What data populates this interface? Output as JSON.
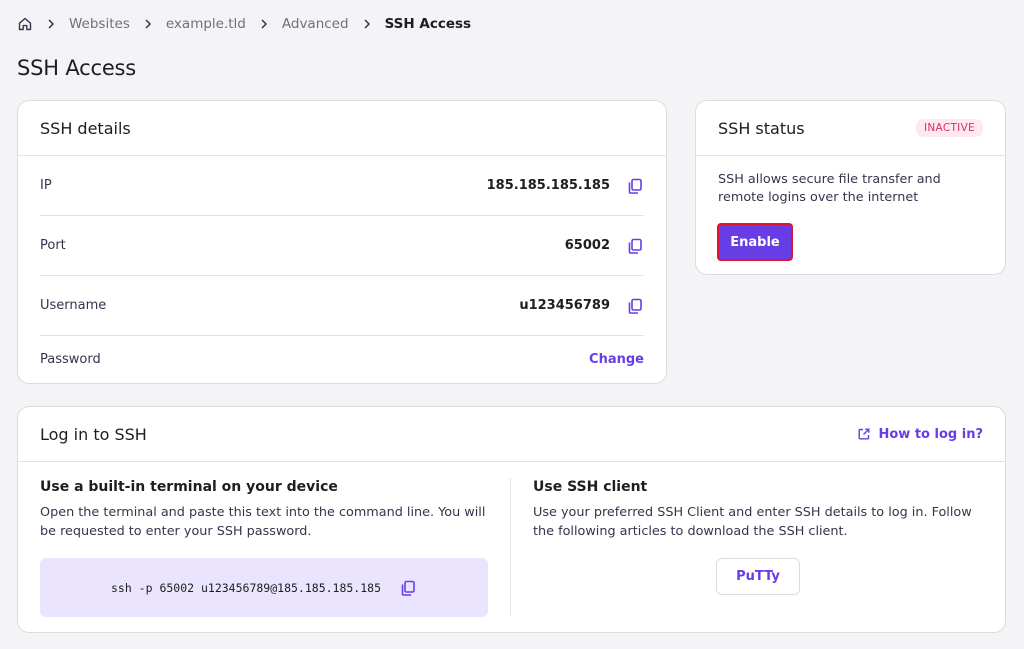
{
  "breadcrumb": {
    "items": [
      "Websites",
      "example.tld",
      "Advanced"
    ],
    "current": "SSH Access"
  },
  "page_title": "SSH Access",
  "ssh_details": {
    "title": "SSH details",
    "rows": [
      {
        "label": "IP",
        "value": "185.185.185.185"
      },
      {
        "label": "Port",
        "value": "65002"
      },
      {
        "label": "Username",
        "value": "u123456789"
      },
      {
        "label": "Password",
        "action": "Change"
      }
    ]
  },
  "ssh_status": {
    "title": "SSH status",
    "badge": "INACTIVE",
    "description": "SSH allows secure file transfer and remote logins over the internet",
    "enable_label": "Enable"
  },
  "login": {
    "title": "Log in to SSH",
    "help_link": "How to log in?",
    "terminal": {
      "heading": "Use a built-in terminal on your device",
      "description": "Open the terminal and paste this text into the command line. You will be requested to enter your SSH password.",
      "command": "ssh -p 65002 u123456789@185.185.185.185"
    },
    "client": {
      "heading": "Use SSH client",
      "description": "Use your preferred SSH Client and enter SSH details to log in. Follow the following articles to download the SSH client.",
      "putty_label": "PuTTy"
    }
  },
  "colors": {
    "accent": "#673de6",
    "badge_bg": "#ffe8ef",
    "badge_text": "#d63163",
    "highlight_border": "#e0162b",
    "command_bg": "#ebe4ff"
  },
  "icons": [
    "home-icon",
    "chevron-right-icon",
    "copy-icon",
    "external-link-icon"
  ]
}
